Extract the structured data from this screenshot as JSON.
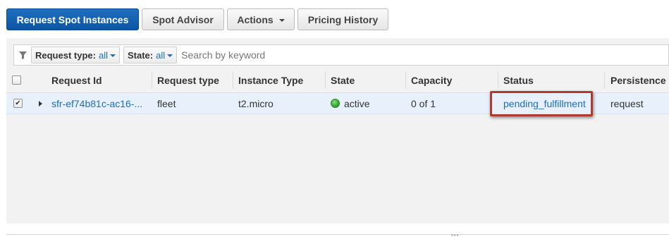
{
  "toolbar": {
    "request_spot_label": "Request Spot Instances",
    "spot_advisor_label": "Spot Advisor",
    "actions_label": "Actions",
    "pricing_history_label": "Pricing History"
  },
  "filter": {
    "request_type_label": "Request type:",
    "request_type_value": "all",
    "state_label": "State:",
    "state_value": "all",
    "search_placeholder": "Search by keyword"
  },
  "table": {
    "columns": [
      "Request Id",
      "Request type",
      "Instance Type",
      "State",
      "Capacity",
      "Status",
      "Persistence"
    ],
    "rows": [
      {
        "selected": true,
        "request_id": "sfr-ef74b81c-ac16-...",
        "request_type": "fleet",
        "instance_type": "t2.micro",
        "state": "active",
        "capacity": "0 of 1",
        "status": "pending_fulfillment",
        "persistence": "request"
      }
    ]
  },
  "colors": {
    "primary_button": "#0b56a4",
    "link": "#1a6dbd",
    "state_active": "#2e9b25",
    "highlight_box": "#b03a2e",
    "selected_row": "#e8f1fb"
  },
  "icons": {
    "filter": "funnel-icon",
    "row_expand": "triangle-right-icon",
    "state": "green-dot-icon",
    "dropdown": "chevron-down-icon"
  }
}
